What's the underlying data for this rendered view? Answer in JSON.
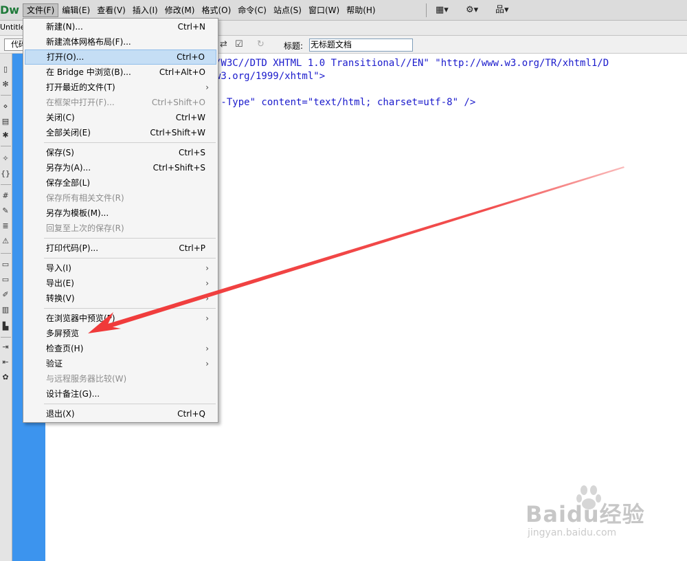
{
  "app": {
    "logo": "Dw"
  },
  "menubar": {
    "items": [
      {
        "label": "文件(F)",
        "active": true
      },
      {
        "label": "编辑(E)"
      },
      {
        "label": "查看(V)"
      },
      {
        "label": "插入(I)"
      },
      {
        "label": "修改(M)"
      },
      {
        "label": "格式(O)"
      },
      {
        "label": "命令(C)"
      },
      {
        "label": "站点(S)"
      },
      {
        "label": "窗口(W)"
      },
      {
        "label": "帮助(H)"
      }
    ],
    "icons": [
      "layout-icon",
      "gear-icon",
      "site-icon"
    ]
  },
  "document": {
    "tab_title": "Untitle"
  },
  "toolbar": {
    "view_label": "代码",
    "title_label": "标题:",
    "title_value": "无标题文档"
  },
  "code": {
    "line1": "/W3C//DTD XHTML 1.0 Transitional//EN\" \"http://www.w3.org/TR/xhtml1/D",
    "line2": "w3.org/1999/xhtml\">",
    "line3": ":-Type\" content=\"text/html; charset=utf-8\" />"
  },
  "file_menu": {
    "groups": [
      [
        {
          "label": "新建(N)...",
          "shortcut": "Ctrl+N"
        },
        {
          "label": "新建流体网格布局(F)...",
          "shortcut": ""
        },
        {
          "label": "打开(O)...",
          "shortcut": "Ctrl+O",
          "highlighted": true
        },
        {
          "label": "在 Bridge 中浏览(B)...",
          "shortcut": "Ctrl+Alt+O"
        },
        {
          "label": "打开最近的文件(T)",
          "shortcut": "",
          "submenu": true
        },
        {
          "label": "在框架中打开(F)...",
          "shortcut": "Ctrl+Shift+O",
          "disabled": true
        },
        {
          "label": "关闭(C)",
          "shortcut": "Ctrl+W"
        },
        {
          "label": "全部关闭(E)",
          "shortcut": "Ctrl+Shift+W"
        }
      ],
      [
        {
          "label": "保存(S)",
          "shortcut": "Ctrl+S"
        },
        {
          "label": "另存为(A)...",
          "shortcut": "Ctrl+Shift+S"
        },
        {
          "label": "保存全部(L)",
          "shortcut": ""
        },
        {
          "label": "保存所有相关文件(R)",
          "shortcut": "",
          "disabled": true
        },
        {
          "label": "另存为模板(M)...",
          "shortcut": ""
        },
        {
          "label": "回复至上次的保存(R)",
          "shortcut": "",
          "disabled": true
        }
      ],
      [
        {
          "label": "打印代码(P)...",
          "shortcut": "Ctrl+P"
        }
      ],
      [
        {
          "label": "导入(I)",
          "shortcut": "",
          "submenu": true
        },
        {
          "label": "导出(E)",
          "shortcut": "",
          "submenu": true
        },
        {
          "label": "转换(V)",
          "shortcut": "",
          "submenu": true
        }
      ],
      [
        {
          "label": "在浏览器中预览(P)",
          "shortcut": "",
          "submenu": true
        },
        {
          "label": "多屏预览",
          "shortcut": ""
        },
        {
          "label": "检查页(H)",
          "shortcut": "",
          "submenu": true
        },
        {
          "label": "验证",
          "shortcut": "",
          "submenu": true
        },
        {
          "label": "与远程服务器比较(W)",
          "shortcut": "",
          "disabled": true
        },
        {
          "label": "设计备注(G)...",
          "shortcut": ""
        }
      ],
      [
        {
          "label": "退出(X)",
          "shortcut": "Ctrl+Q"
        }
      ]
    ]
  },
  "annotation": {
    "color": "#f03a3a"
  },
  "watermark": {
    "brand": "Baidu经验",
    "url": "jingyan.baidu.com"
  }
}
